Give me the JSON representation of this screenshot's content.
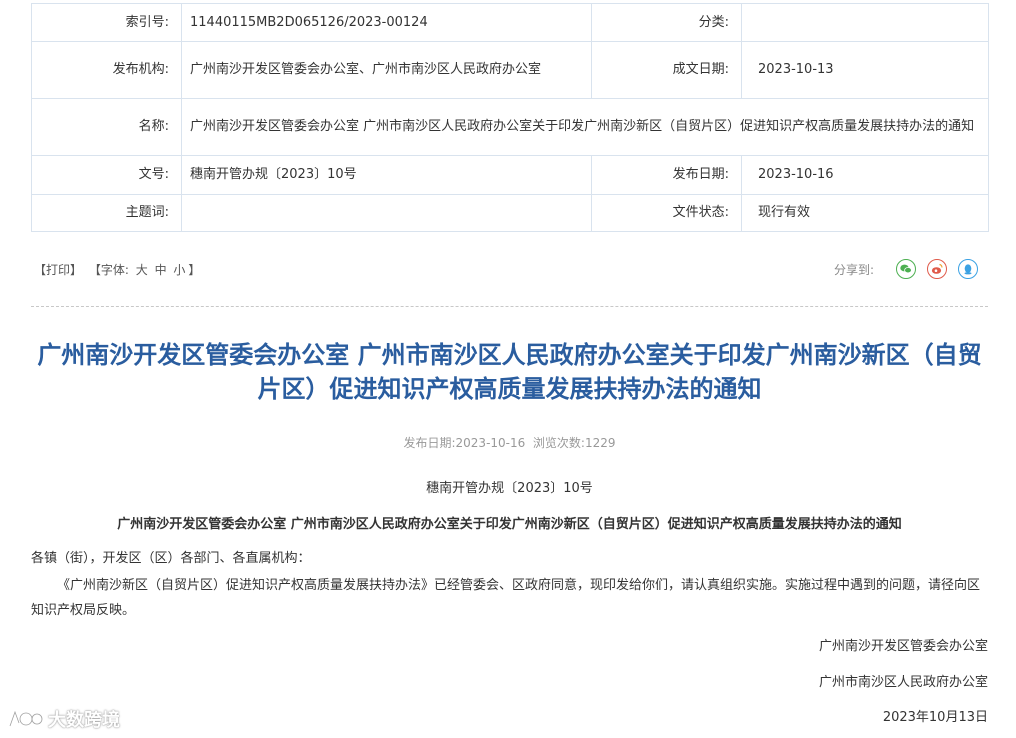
{
  "meta": {
    "index_label": "索引号:",
    "index_value": "11440115MB2D065126/2023-00124",
    "category_label": "分类:",
    "category_value": "",
    "issuer_label": "发布机构:",
    "issuer_value": "广州南沙开发区管委会办公室、广州市南沙区人民政府办公室",
    "created_label": "成文日期:",
    "created_value": "2023-10-13",
    "name_label": "名称:",
    "name_value": "广州南沙开发区管委会办公室 广州市南沙区人民政府办公室关于印发广州南沙新区（自贸片区）促进知识产权高质量发展扶持办法的通知",
    "docno_label": "文号:",
    "docno_value": "穗南开管办规〔2023〕10号",
    "published_label": "发布日期:",
    "published_value": "2023-10-16",
    "keywords_label": "主题词:",
    "keywords_value": "",
    "status_label": "文件状态:",
    "status_value": "现行有效"
  },
  "tools": {
    "print": "【打印】",
    "font_prefix": "【字体:",
    "font_large": "大",
    "font_medium": "中",
    "font_small": "小",
    "font_suffix": "】",
    "share_label": "分享到:",
    "share_icons": [
      "wechat-icon",
      "weibo-icon",
      "qq-icon"
    ]
  },
  "article": {
    "title": "广州南沙开发区管委会办公室 广州市南沙区人民政府办公室关于印发广州南沙新区（自贸片区）促进知识产权高质量发展扶持办法的通知",
    "pub_date_label": "发布日期:",
    "pub_date": "2023-10-16",
    "views_label": "浏览次数:",
    "views": "1229",
    "doc_number": "穗南开管办规〔2023〕10号",
    "subject": "广州南沙开发区管委会办公室  广州市南沙区人民政府办公室关于印发广州南沙新区（自贸片区）促进知识产权高质量发展扶持办法的通知",
    "salutation": "各镇（街），开发区（区）各部门、各直属机构：",
    "body": "《广州南沙新区（自贸片区）促进知识产权高质量发展扶持办法》已经管委会、区政府同意，现印发给你们，请认真组织实施。实施过程中遇到的问题，请径向区知识产权局反映。",
    "signatory_1": "广州南沙开发区管委会办公室",
    "signatory_2": "广州市南沙区人民政府办公室",
    "sign_date": "2023年10月13日"
  },
  "watermark": {
    "text": "大数跨境"
  },
  "colors": {
    "title": "#2a5d9f",
    "border": "#d9e3ee",
    "muted": "#999999"
  }
}
